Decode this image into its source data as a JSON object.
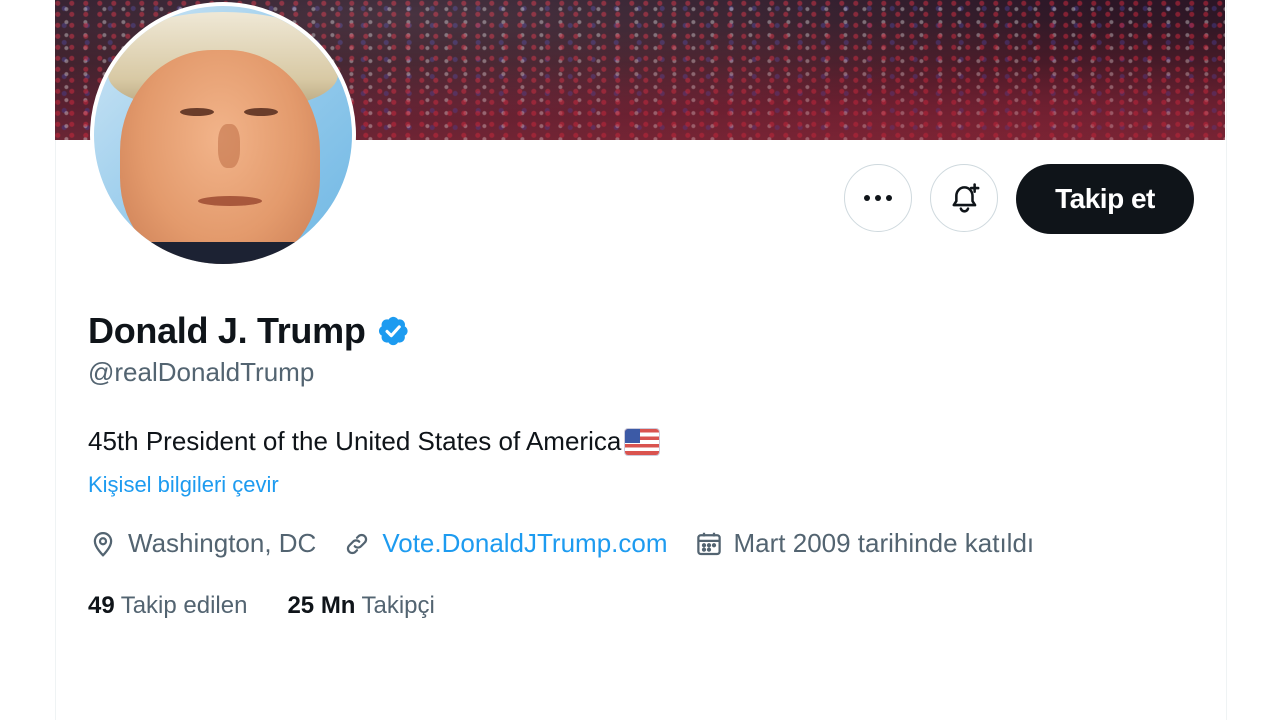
{
  "profile": {
    "name": "Donald J. Trump",
    "handle": "@realDonaldTrump",
    "verified": true,
    "bio": "45th President of the United States of America",
    "bio_emoji": "us-flag",
    "translate_label": "Kişisel bilgileri çevir",
    "location": "Washington, DC",
    "website": "Vote.DonaldJTrump.com",
    "joined": "Mart 2009 tarihinde katıldı"
  },
  "actions": {
    "more_icon": "more-icon",
    "notify_icon": "bell-plus-icon",
    "follow_label": "Takip et"
  },
  "stats": {
    "following_count": "49",
    "following_label": "Takip edilen",
    "followers_count": "25 Mn",
    "followers_label": "Takipçi"
  },
  "colors": {
    "accent": "#1d9bf0",
    "text": "#0f1419",
    "muted": "#536471",
    "button_dark": "#0f1419"
  }
}
